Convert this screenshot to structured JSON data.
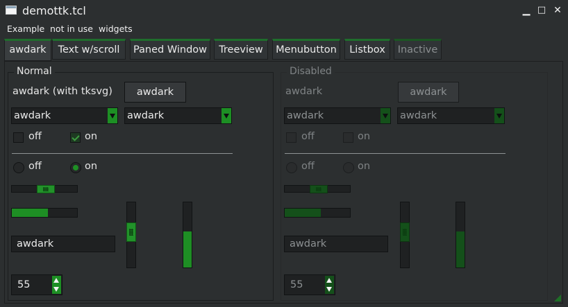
{
  "window": {
    "title": "demottk.tcl",
    "minimize": "▁",
    "maximize": "□",
    "close": "✕",
    "icon": "window-icon"
  },
  "menubar": {
    "items": [
      "Example",
      "not in use",
      "widgets"
    ]
  },
  "tabs": [
    {
      "label": "awdark",
      "selected": true
    },
    {
      "label": "Text w/scroll"
    },
    {
      "label": "Paned Window"
    },
    {
      "label": "Treeview"
    },
    {
      "label": "Menubutton"
    },
    {
      "label": "Listbox"
    },
    {
      "label": "Inactive",
      "disabled": true
    }
  ],
  "normal": {
    "frame_label": "Normal",
    "button_caption": "awdark (with tksvg)",
    "button_label": "awdark",
    "combo1_value": "awdark",
    "combo2_value": "awdark",
    "check_off_label": "off",
    "check_on_label": "on",
    "radio_off_label": "off",
    "radio_on_label": "on",
    "hscale_value": 0.52,
    "hprogress_value": 0.5,
    "vscale_value": 0.5,
    "vprogress_value": 0.55,
    "entry_value": "awdark",
    "spin_value": "55"
  },
  "disabled": {
    "frame_label": "Disabled",
    "button_caption": "awdark",
    "button_label": "awdark",
    "combo1_value": "awdark",
    "combo2_value": "awdark",
    "check_off_label": "off",
    "check_on_label": "on",
    "radio_off_label": "off",
    "radio_on_label": "on",
    "entry_value": "awdark",
    "spin_value": "55"
  },
  "colors": {
    "accent": "#1e8e24",
    "background": "#2c2f30",
    "field": "#1f2122"
  }
}
